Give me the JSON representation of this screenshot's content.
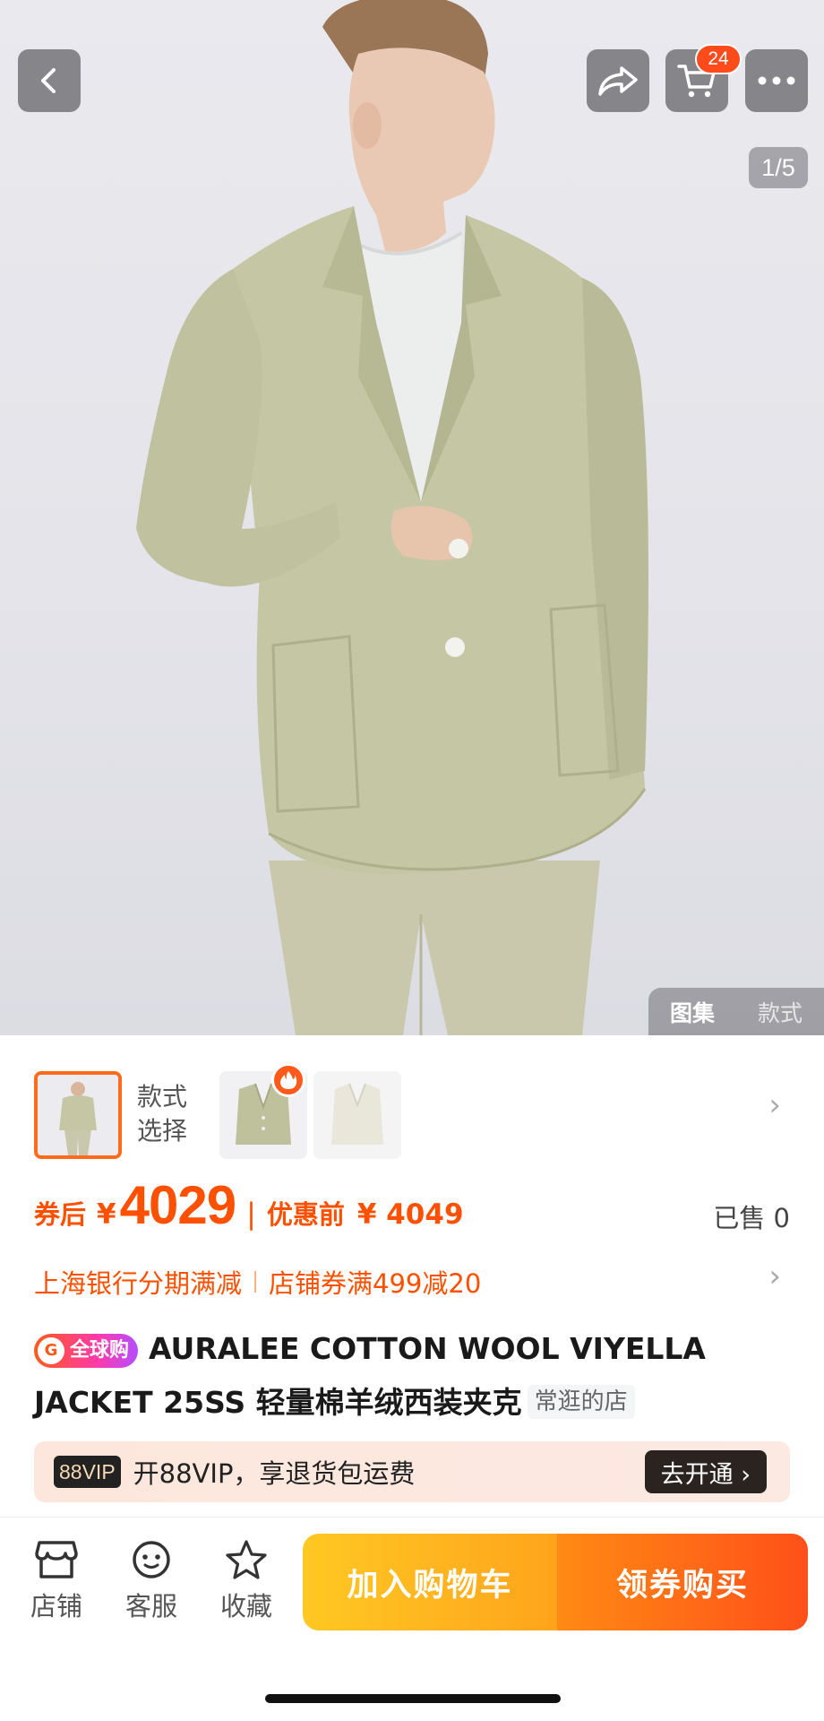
{
  "header": {
    "back_icon": "chevron-left-icon",
    "share_icon": "share-arrow-icon",
    "cart_icon": "cart-icon",
    "cart_count": "24",
    "more_icon": "more-dots-icon"
  },
  "gallery": {
    "page_indicator": "1/5",
    "tabs": [
      {
        "label": "图集",
        "active": true
      },
      {
        "label": "款式",
        "active": false
      }
    ]
  },
  "styles": {
    "label_line1": "款式",
    "label_line2": "选择",
    "selected_index": 0,
    "thumb_count": 3
  },
  "price": {
    "after_coupon_label": "券后",
    "currency": "¥",
    "after_coupon_value": "4029",
    "separator": "|",
    "before_label": "优惠前",
    "before_value": "¥ 4049",
    "sold_text": "已售 0"
  },
  "promos": [
    "上海银行分期满减",
    "店铺券满499减20"
  ],
  "product": {
    "badge_icon_text": "G",
    "badge_label": "全球购",
    "title": "AURALEE COTTON WOOL VIYELLA JACKET 25SS 轻量棉羊绒西装夹克",
    "shop_tag": "常逛的店"
  },
  "vip": {
    "tag": "88VIP",
    "text": "开88VIP，享退货包运费",
    "button": "去开通 ›"
  },
  "bottom_bar": {
    "store_label": "店铺",
    "service_label": "客服",
    "favorite_label": "收藏",
    "add_to_cart": "加入购物车",
    "buy_with_coupon": "领券购买"
  },
  "colors": {
    "accent": "#ff5000",
    "cart_button": "#ffb01e",
    "buy_button": "#ff6a17",
    "badge": "#ff4a1c"
  }
}
